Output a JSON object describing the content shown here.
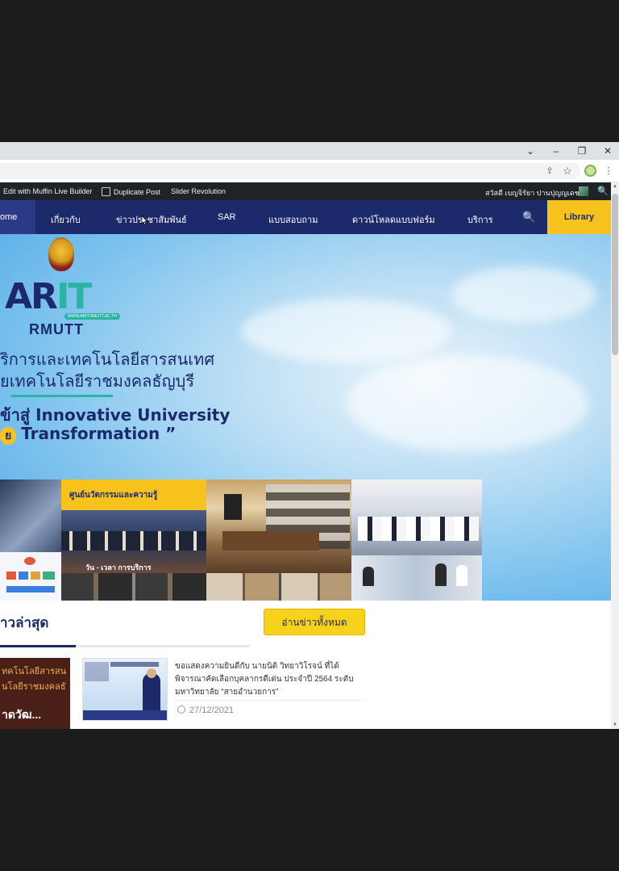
{
  "browser": {
    "window_controls": {
      "collapse": "⌄",
      "minimize": "–",
      "restore": "❐",
      "close": "✕"
    },
    "toolbar_icons": [
      "share-icon",
      "star-icon",
      "extension-icon",
      "menu-icon"
    ],
    "toolbar_glyphs": {
      "share": "⇪",
      "star": "☆",
      "menu": "⋮"
    }
  },
  "adminbar": {
    "items": [
      "Edit with Muffin Live Builder",
      "Duplicate Post",
      "Slider Revolution"
    ],
    "greeting": "สวัสดี เบญจิรัยา ปานปุญญเดช",
    "search_glyph": "🔍"
  },
  "nav": {
    "home": "ome",
    "items": [
      "เกี่ยวกับ",
      "ข่าวประชาสัมพันธ์",
      "SAR",
      "แบบสอบถาม",
      "ดาวน์โหลดแบบฟอร์ม",
      "บริการ"
    ],
    "search_glyph": "🔍",
    "library": "Library"
  },
  "hero": {
    "logo_main_left": "AR",
    "logo_main_it": "IT",
    "logo_badge": "WWW.ARIT.RMUTT.AC.TH",
    "logo_sub": "RMUTT",
    "line1": "ริการและเทคโนโลยีสารสนเทศ",
    "line2": "ยเทคโนโลยีราชมงคลธัญบุรี",
    "line3": "ข้าสู่ Innovative University",
    "line4_pill": "ย",
    "line4": "Transformation ”",
    "collage_label1": "ศูนย์นวัตกรรมและความรู้",
    "collage_label2": "วัน - เวลา การบริการ"
  },
  "news": {
    "title": "าวล่าสุด",
    "read_all": "อ่านข่าวทั้งหมด",
    "thumb1_lines": [
      "ทคโนโลยีสารสน",
      "นโลยีราชมงคลธั",
      "าดวัฒ..."
    ],
    "item_text": "ขอแสดงความยินดีกับ นายนิติ วิทยาวิโรจน์ ที่ได้พิจารณาคัดเลือกบุคลากรดีเด่น ประจำปี 2564 ระดับมหาวิทยาลัย “สายอำนวยการ”",
    "item_date": "27/12/2021"
  },
  "colors": {
    "nav_bg": "#1c2a6b",
    "accent_yellow": "#f7c21c",
    "accent_teal": "#2bb3a3",
    "admin_bg": "#1d2327"
  }
}
